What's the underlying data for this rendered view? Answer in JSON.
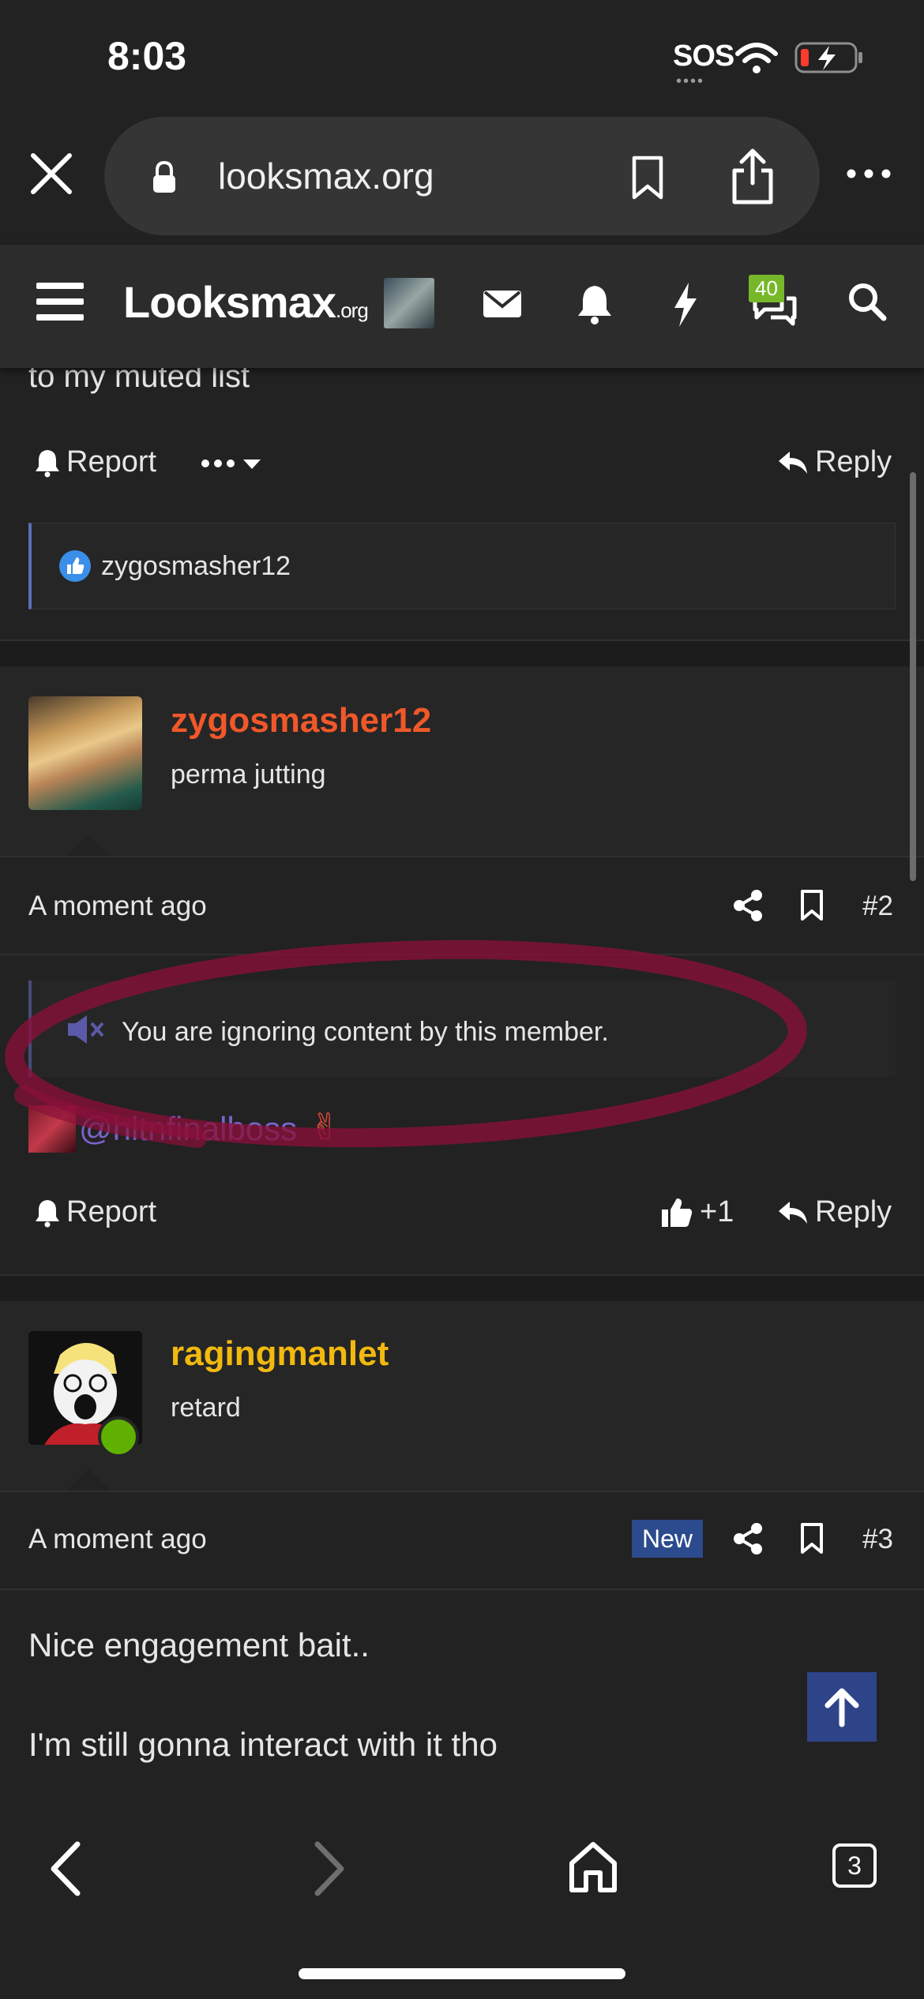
{
  "status_bar": {
    "time": "8:03",
    "sos": "SOS"
  },
  "browser": {
    "url": "looksmax.org",
    "tab_count": "3"
  },
  "site_nav": {
    "logo": "Looksmax",
    "logo_suffix": ".org",
    "alerts_badge": "40"
  },
  "post1": {
    "text_tail": "to my muted list",
    "report": "Report",
    "reply": "Reply",
    "reaction_user": "zygosmasher12"
  },
  "post2": {
    "username": "zygosmasher12",
    "user_title": "perma jutting",
    "time": "A moment ago",
    "number": "#2",
    "ignore_notice": "You are ignoring content by this member.",
    "mention": "@hltnfinalboss",
    "report": "Report",
    "like_count": "+1",
    "reply": "Reply"
  },
  "post3": {
    "username": "ragingmanlet",
    "user_title": "retard",
    "time": "A moment ago",
    "new_label": "New",
    "number": "#3",
    "line1": "Nice engagement bait..",
    "line2": "I'm still gonna interact with it tho"
  },
  "colors": {
    "username_orange": "#f0582a",
    "username_gold": "#f2b90f",
    "accent_blue": "#2e4489",
    "badge_green": "#76b82a",
    "annotation_red": "#8a0f3a"
  }
}
